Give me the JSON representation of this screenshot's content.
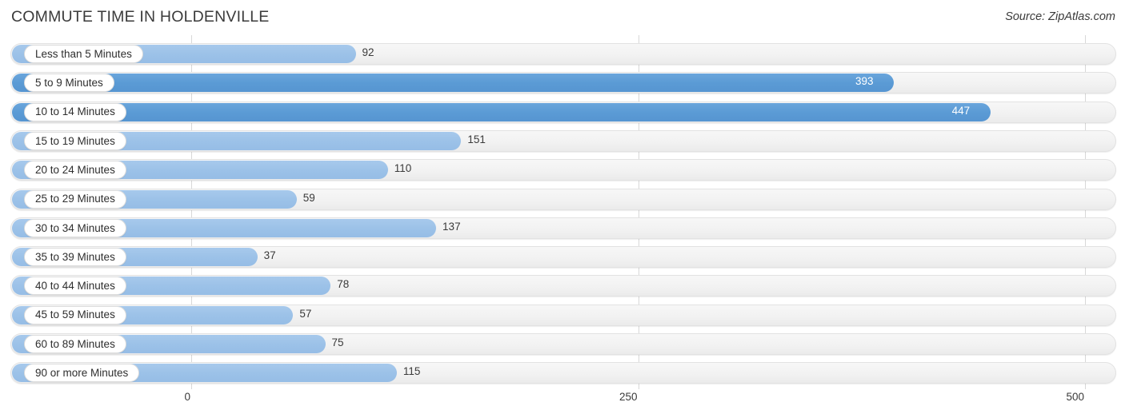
{
  "header": {
    "title": "COMMUTE TIME IN HOLDENVILLE",
    "source": "Source: ZipAtlas.com"
  },
  "colors": {
    "bar_light": "#9cc2e8",
    "bar_dark": "#5b9bd5",
    "track": "#f2f2f2",
    "gridline": "#d8d8d8",
    "text": "#3a3a3a",
    "value_inside": "#ffffff"
  },
  "chart_data": {
    "type": "bar",
    "orientation": "horizontal",
    "title": "COMMUTE TIME IN HOLDENVILLE",
    "subtitle": "",
    "xlabel": "",
    "ylabel": "",
    "xlim": [
      0,
      500
    ],
    "ticks": [
      0,
      250,
      500
    ],
    "tick_labels": [
      "0",
      "250",
      "500"
    ],
    "grid": true,
    "legend": false,
    "categories": [
      "Less than 5 Minutes",
      "5 to 9 Minutes",
      "10 to 14 Minutes",
      "15 to 19 Minutes",
      "20 to 24 Minutes",
      "25 to 29 Minutes",
      "30 to 34 Minutes",
      "35 to 39 Minutes",
      "40 to 44 Minutes",
      "45 to 59 Minutes",
      "60 to 89 Minutes",
      "90 or more Minutes"
    ],
    "values": [
      92,
      393,
      447,
      151,
      110,
      59,
      137,
      37,
      78,
      57,
      75,
      115
    ],
    "value_labels": [
      "92",
      "393",
      "447",
      "151",
      "110",
      "59",
      "137",
      "37",
      "78",
      "57",
      "75",
      "115"
    ],
    "highlight_indices": [
      1,
      2
    ],
    "annotations": []
  }
}
